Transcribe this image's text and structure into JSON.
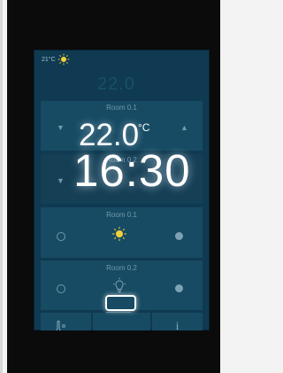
{
  "status_bar": {
    "temperature": "21°C",
    "weather_icon": "sun-icon",
    "ghost_temperature": "22.0"
  },
  "rows": [
    {
      "title": "Room 0.1",
      "left_control": "▼",
      "right_control": "▲"
    },
    {
      "title": "Room 0.2",
      "left_control": "▼"
    },
    {
      "title": "Room 0.1",
      "left_icon": "radio-empty-icon",
      "center_icon": "sun-icon",
      "right_icon": "radio-filled-icon"
    },
    {
      "title": "Room 0.2",
      "left_icon": "radio-empty-icon",
      "center_icon": "lightbulb-icon",
      "right_icon": "radio-filled-icon"
    }
  ],
  "overlay": {
    "temperature": "22.0",
    "unit": "°C",
    "time": "16:30"
  },
  "bottom_nav": [
    {
      "label": "",
      "icon": "thermometer-icon"
    },
    {
      "label": "",
      "icon": "home-key-icon"
    },
    {
      "label": "i",
      "icon": "info-icon"
    }
  ],
  "colors": {
    "frame": "#0b0b0b",
    "screen": "#0f3a51",
    "tile": "#174b63",
    "accent_sun": "#f2d03c",
    "glow_white": "#ffffff"
  }
}
